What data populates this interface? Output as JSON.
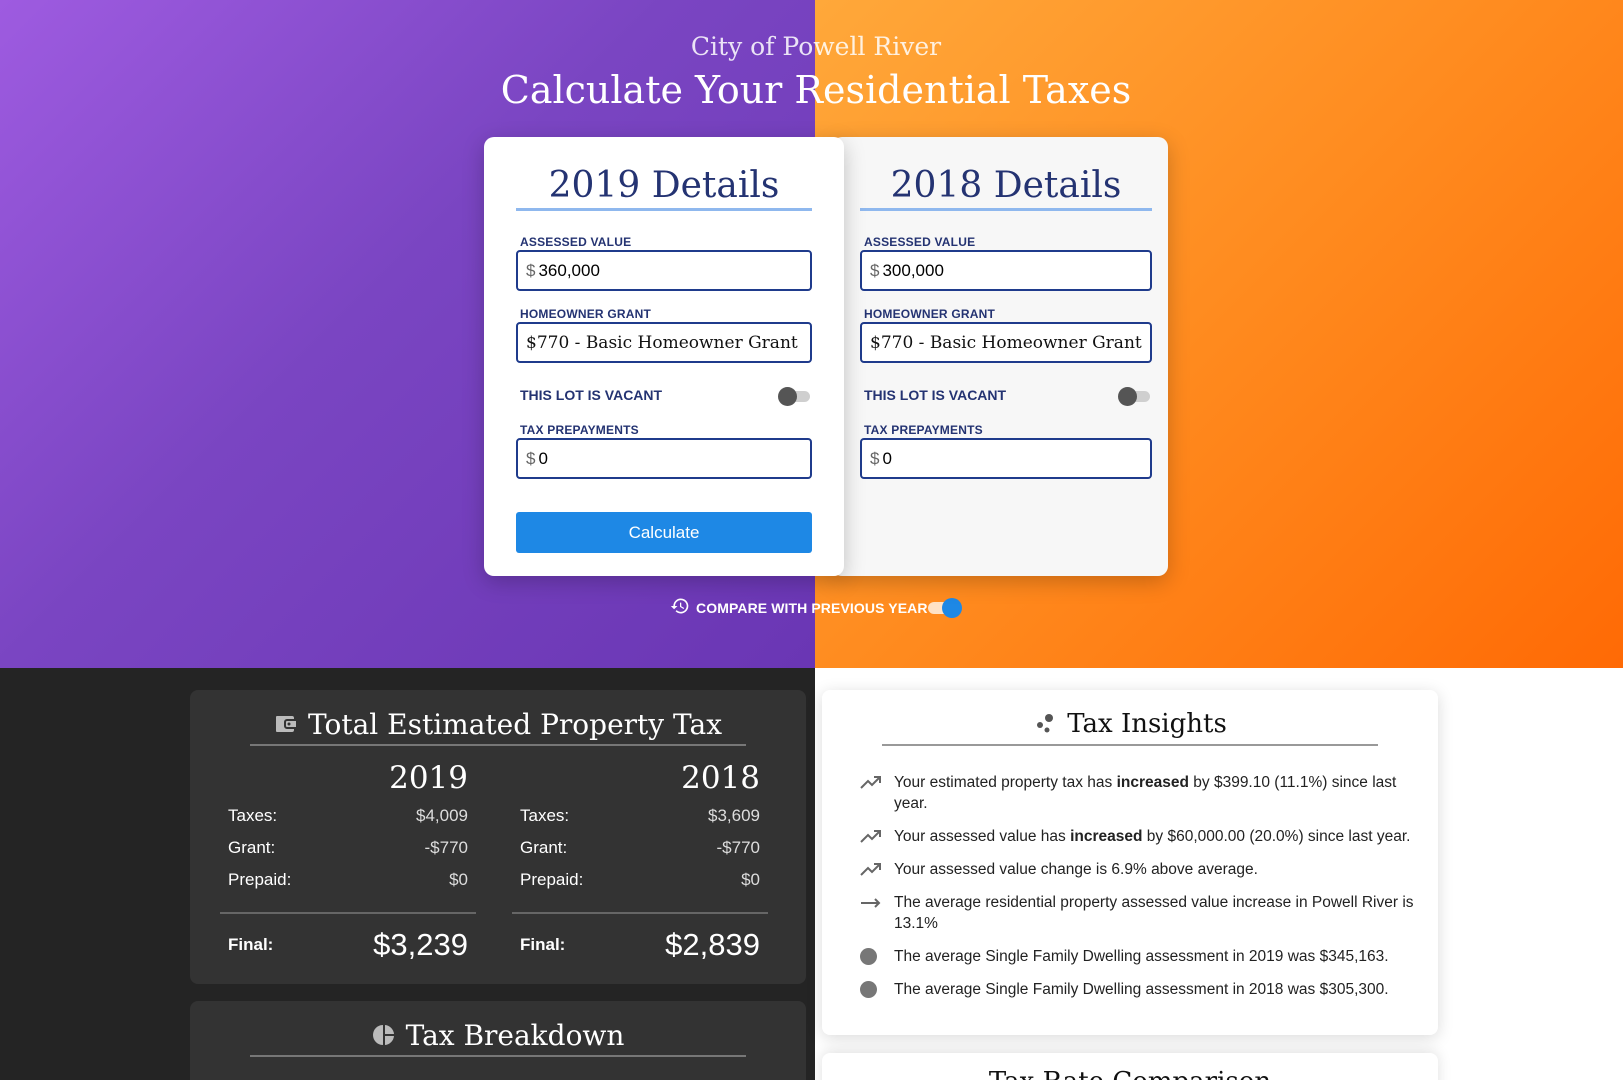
{
  "header": {
    "subtitle": "City of Powell River",
    "title": "Calculate Your Residential Taxes"
  },
  "form_2019": {
    "title": "2019 Details",
    "assessed_label": "ASSESSED VALUE",
    "currency": "$",
    "assessed_value": "360,000",
    "grant_label": "HOMEOWNER GRANT",
    "grant_value": "$770 - Basic Homeowner Grant",
    "vacant_label": "THIS LOT IS VACANT",
    "vacant": false,
    "prepay_label": "TAX PREPAYMENTS",
    "prepay_value": "0",
    "calculate_label": "Calculate"
  },
  "form_2018": {
    "title": "2018 Details",
    "assessed_label": "ASSESSED VALUE",
    "currency": "$",
    "assessed_value": "300,000",
    "grant_label": "HOMEOWNER GRANT",
    "grant_value": "$770 - Basic Homeowner Grant",
    "vacant_label": "THIS LOT IS VACANT",
    "vacant": false,
    "prepay_label": "TAX PREPAYMENTS",
    "prepay_value": "0"
  },
  "compare": {
    "label": "COMPARE WITH PREVIOUS YEAR",
    "enabled": true,
    "icon": "history-icon"
  },
  "total": {
    "title": "Total Estimated Property Tax",
    "icon": "wallet-icon",
    "years": [
      {
        "year": "2019",
        "taxes_label": "Taxes:",
        "taxes": "$4,009",
        "grant_label": "Grant:",
        "grant": "-$770",
        "prepaid_label": "Prepaid:",
        "prepaid": "$0",
        "final_label": "Final:",
        "final": "$3,239"
      },
      {
        "year": "2018",
        "taxes_label": "Taxes:",
        "taxes": "$3,609",
        "grant_label": "Grant:",
        "grant": "-$770",
        "prepaid_label": "Prepaid:",
        "prepaid": "$0",
        "final_label": "Final:",
        "final": "$2,839"
      }
    ]
  },
  "breakdown": {
    "title": "Tax Breakdown",
    "icon": "pie-chart-icon"
  },
  "insights": {
    "title": "Tax Insights",
    "icon": "bubbles-icon",
    "items": [
      {
        "icon": "trending-up-icon",
        "pre": "Your estimated property tax has ",
        "bold": "increased",
        "post": " by $399.10 (11.1%) since last year."
      },
      {
        "icon": "trending-up-icon",
        "pre": "Your assessed value has ",
        "bold": "increased",
        "post": " by $60,000.00 (20.0%) since last year."
      },
      {
        "icon": "trending-up-icon",
        "pre": "Your assessed value change is 6.9% above average.",
        "bold": "",
        "post": ""
      },
      {
        "icon": "arrow-right-icon",
        "pre": "The average residential property assessed value increase in Powell River is 13.1%",
        "bold": "",
        "post": ""
      },
      {
        "icon": "dot-icon",
        "pre": "The average Single Family Dwelling assessment in 2019 was $345,163.",
        "bold": "",
        "post": ""
      },
      {
        "icon": "dot-icon",
        "pre": "The average Single Family Dwelling assessment in 2018 was $305,300.",
        "bold": "",
        "post": ""
      }
    ]
  },
  "next_card": {
    "title": "Tax Rate Comparison"
  },
  "colors": {
    "purple": "#7a45c2",
    "orange": "#ff8a1e",
    "navy": "#243372",
    "accent_blue": "#1e88e5",
    "dark": "#242424",
    "card_dark": "#333333"
  }
}
